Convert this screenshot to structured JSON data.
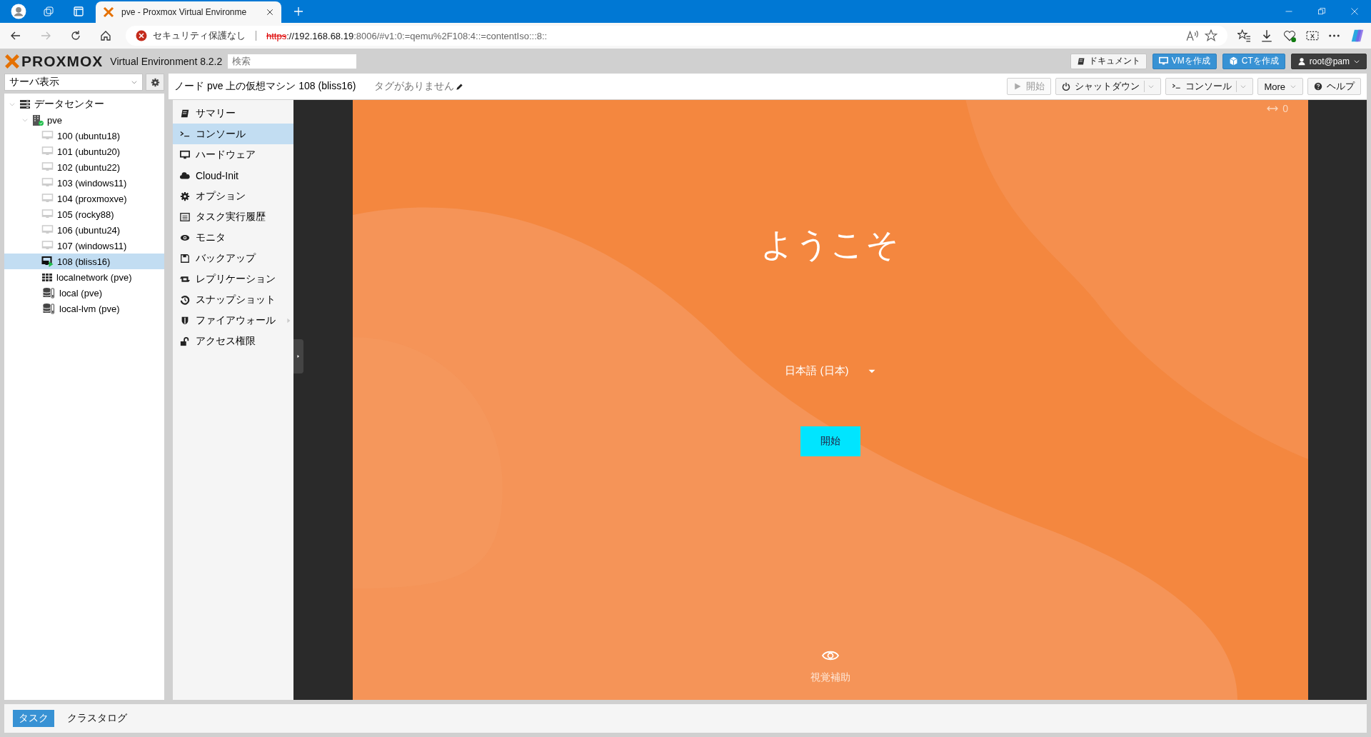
{
  "browser": {
    "tab_title": "pve - Proxmox Virtual Environme",
    "address": {
      "security": "セキュリティ保護なし",
      "scheme": "https",
      "host": "://192.168.68.19",
      "path": ":8006/#v1:0:=qemu%2F108:4::=contentIso:::8::"
    }
  },
  "header": {
    "logo": "PROXMOX",
    "version": "Virtual Environment 8.2.2",
    "search": {
      "placeholder": "検索"
    },
    "buttons": [
      {
        "label": "ドキュメント",
        "kind": "plain"
      },
      {
        "label": "VMを作成",
        "kind": "vm"
      },
      {
        "label": "CTを作成",
        "kind": "ct"
      },
      {
        "label": "root@pam",
        "kind": "user"
      }
    ]
  },
  "view_select": {
    "value": "サーバ表示"
  },
  "toolbar": {
    "title": "ノード pve 上の仮想マシン 108 (bliss16)",
    "tags": "タグがありません",
    "buttons": [
      {
        "label": "開始",
        "kind": "start",
        "disabled": true,
        "split": false
      },
      {
        "label": "シャットダウン",
        "kind": "power",
        "disabled": false,
        "split": true
      },
      {
        "label": "コンソール",
        "kind": "console",
        "disabled": false,
        "split": true
      },
      {
        "label": "More",
        "kind": "more",
        "disabled": false,
        "split": false
      },
      {
        "label": "ヘルプ",
        "kind": "help",
        "disabled": false,
        "split": false
      }
    ]
  },
  "tree": [
    {
      "label": "データセンター",
      "kind": "datacenter",
      "expanded": true,
      "selected": false,
      "children": [
        {
          "label": "pve",
          "kind": "node",
          "expanded": true,
          "selected": false,
          "children": [
            {
              "label": "100 (ubuntu18)",
              "kind": "vm",
              "running": false,
              "selected": false
            },
            {
              "label": "101 (ubuntu20)",
              "kind": "vm",
              "running": false,
              "selected": false
            },
            {
              "label": "102 (ubuntu22)",
              "kind": "vm",
              "running": false,
              "selected": false
            },
            {
              "label": "103 (windows11)",
              "kind": "vm",
              "running": false,
              "selected": false
            },
            {
              "label": "104 (proxmoxve)",
              "kind": "vm",
              "running": false,
              "selected": false
            },
            {
              "label": "105 (rocky88)",
              "kind": "vm",
              "running": false,
              "selected": false
            },
            {
              "label": "106 (ubuntu24)",
              "kind": "vm",
              "running": false,
              "selected": false
            },
            {
              "label": "107 (windows11)",
              "kind": "vm",
              "running": false,
              "selected": false
            },
            {
              "label": "108 (bliss16)",
              "kind": "vm",
              "running": true,
              "selected": true
            },
            {
              "label": "localnetwork (pve)",
              "kind": "sdn",
              "selected": false
            },
            {
              "label": "local (pve)",
              "kind": "storage",
              "selected": false
            },
            {
              "label": "local-lvm (pve)",
              "kind": "storage",
              "selected": false
            }
          ]
        }
      ]
    }
  ],
  "menu": [
    {
      "label": "サマリー",
      "kind": "book",
      "selected": false,
      "submenu": false
    },
    {
      "label": "コンソール",
      "kind": "terminal",
      "selected": true,
      "submenu": false
    },
    {
      "label": "ハードウェア",
      "kind": "monitor",
      "selected": false,
      "submenu": false
    },
    {
      "label": "Cloud-Init",
      "kind": "cloud",
      "selected": false,
      "submenu": false
    },
    {
      "label": "オプション",
      "kind": "gear",
      "selected": false,
      "submenu": false
    },
    {
      "label": "タスク実行履歴",
      "kind": "list",
      "selected": false,
      "submenu": false
    },
    {
      "label": "モニタ",
      "kind": "eye",
      "selected": false,
      "submenu": false
    },
    {
      "label": "バックアップ",
      "kind": "floppy",
      "selected": false,
      "submenu": false
    },
    {
      "label": "レプリケーション",
      "kind": "retweet",
      "selected": false,
      "submenu": false
    },
    {
      "label": "スナップショット",
      "kind": "history",
      "selected": false,
      "submenu": false
    },
    {
      "label": "ファイアウォール",
      "kind": "shield",
      "selected": false,
      "submenu": true
    },
    {
      "label": "アクセス権限",
      "kind": "unlock",
      "selected": false,
      "submenu": false
    }
  ],
  "console": {
    "corner": "0",
    "welcome": "ようこそ",
    "language": "日本語 (日本)",
    "start": "開始",
    "accessibility": "視覚補助"
  },
  "bottom_tabs": [
    {
      "label": "タスク",
      "selected": true
    },
    {
      "label": "クラスタログ",
      "selected": false
    }
  ]
}
